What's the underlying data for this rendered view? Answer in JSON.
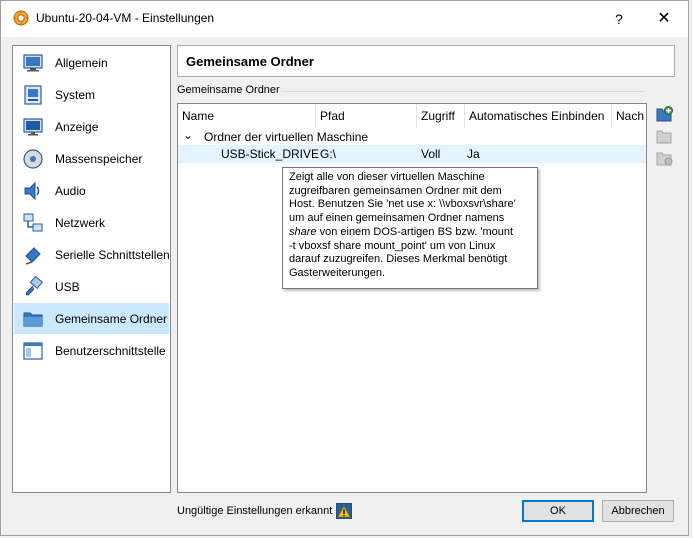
{
  "window": {
    "title": "Ubuntu-20-04-VM - Einstellungen",
    "help_label": "?",
    "close_label": "✕"
  },
  "sidebar": {
    "items": [
      {
        "label": "Allgemein",
        "icon": "general-icon"
      },
      {
        "label": "System",
        "icon": "system-icon"
      },
      {
        "label": "Anzeige",
        "icon": "display-icon"
      },
      {
        "label": "Massenspeicher",
        "icon": "storage-icon"
      },
      {
        "label": "Audio",
        "icon": "audio-icon"
      },
      {
        "label": "Netzwerk",
        "icon": "network-icon"
      },
      {
        "label": "Serielle Schnittstellen",
        "icon": "serial-icon"
      },
      {
        "label": "USB",
        "icon": "usb-icon"
      },
      {
        "label": "Gemeinsame Ordner",
        "icon": "shared-folder-icon",
        "selected": true
      },
      {
        "label": "Benutzerschnittstelle",
        "icon": "user-interface-icon"
      }
    ]
  },
  "page": {
    "title": "Gemeinsame Ordner",
    "group_label": "Gemeinsame Ordner"
  },
  "table": {
    "columns": [
      "Name",
      "Pfad",
      "Zugriff",
      "Automatisches Einbinden",
      "Nach"
    ],
    "group": {
      "expander": "⌄",
      "label": "Ordner der virtuellen Maschine"
    },
    "rows": [
      {
        "name": "USB-Stick_DRIVE",
        "path": "G:\\",
        "access": "Voll",
        "auto_mount": "Ja",
        "mount_point": ""
      }
    ]
  },
  "tooltip": {
    "line1": "Zeigt alle von dieser virtuellen Maschine",
    "line2": "zugreifbaren gemeinsamen Ordner mit dem",
    "line3": "Host. Benutzen Sie 'net use x: \\\\vboxsvr\\share'",
    "line4": "um auf einen gemeinsamen Ordner namens",
    "line5_em": "share",
    "line5_rest": " von einem DOS-artigen BS bzw. 'mount",
    "line6": "-t vboxsf share mount_point' um von Linux",
    "line7": "darauf zuzugreifen. Dieses Merkmal benötigt",
    "line8": "Gasterweiterungen."
  },
  "toolbar": {
    "add": "add-shared-folder-icon",
    "edit": "edit-shared-folder-icon",
    "remove": "remove-shared-folder-icon"
  },
  "status": {
    "text": "Ungültige Einstellungen erkannt",
    "icon": "warning-icon"
  },
  "buttons": {
    "ok": "OK",
    "cancel": "Abbrechen"
  },
  "colors": {
    "selection": "#cce8ff",
    "accent": "#0078d7",
    "row_highlight": "#e5f3ff"
  }
}
